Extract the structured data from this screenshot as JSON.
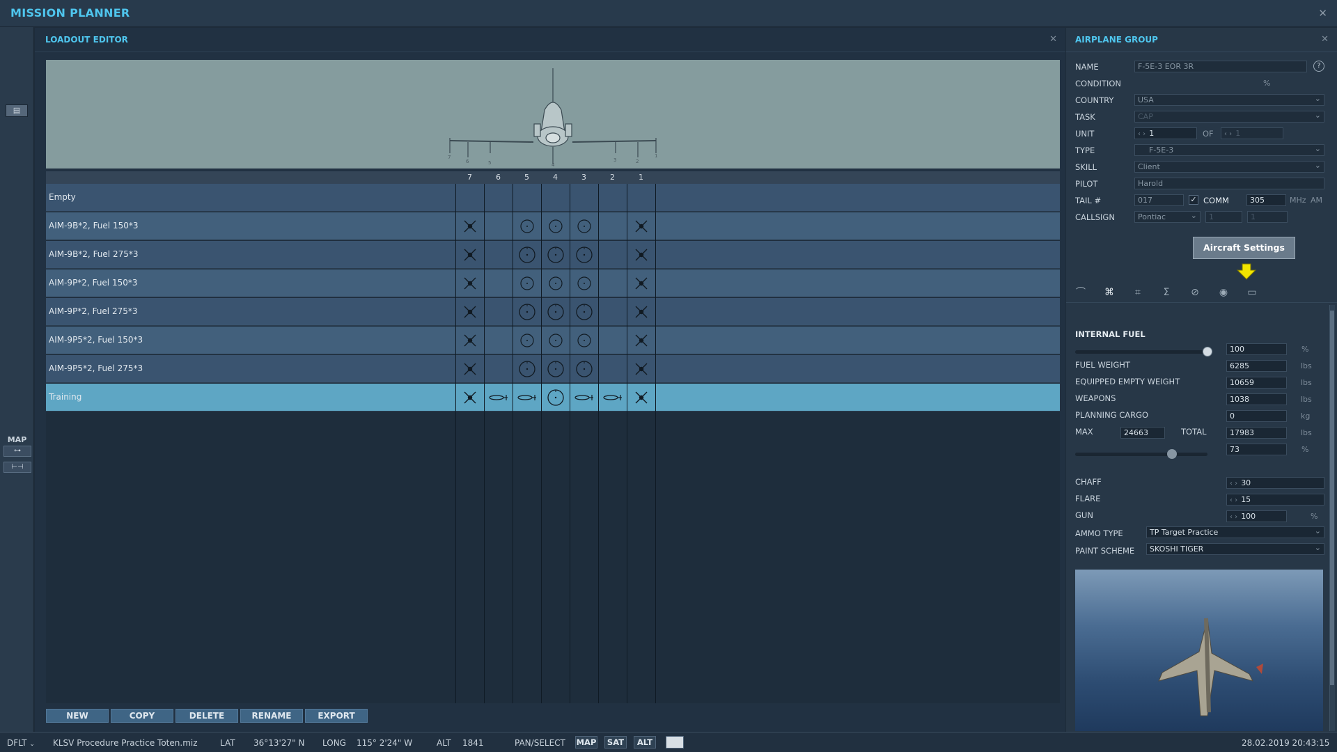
{
  "app": {
    "title": "MISSION PLANNER",
    "close": "✕"
  },
  "leftbar": {
    "map_label": "MAP",
    "map_btn1": "⊶",
    "map_btn2": "⊢⊣",
    "clipboard": "▤"
  },
  "loadout": {
    "title": "LOADOUT EDITOR",
    "close": "✕",
    "stations": [
      "7",
      "6",
      "5",
      "4",
      "3",
      "2",
      "1"
    ],
    "rows": [
      {
        "name": "Empty",
        "stores": [
          "",
          "",
          "",
          "",
          "",
          "",
          ""
        ]
      },
      {
        "name": "AIM-9B*2, Fuel 150*3",
        "stores": [
          "missile",
          "",
          "tank-small",
          "tank-small",
          "tank-small",
          "",
          "missile"
        ]
      },
      {
        "name": "AIM-9B*2, Fuel 275*3",
        "stores": [
          "missile",
          "",
          "tank",
          "tank",
          "tank",
          "",
          "missile"
        ]
      },
      {
        "name": "AIM-9P*2, Fuel 150*3",
        "stores": [
          "missile",
          "",
          "tank-small",
          "tank-small",
          "tank-small",
          "",
          "missile"
        ]
      },
      {
        "name": "AIM-9P*2, Fuel 275*3",
        "stores": [
          "missile",
          "",
          "tank",
          "tank",
          "tank",
          "",
          "missile"
        ]
      },
      {
        "name": "AIM-9P5*2, Fuel 150*3",
        "stores": [
          "missile",
          "",
          "tank-small",
          "tank-small",
          "tank-small",
          "",
          "missile"
        ]
      },
      {
        "name": "AIM-9P5*2, Fuel 275*3",
        "stores": [
          "missile",
          "",
          "tank",
          "tank",
          "tank",
          "",
          "missile"
        ]
      },
      {
        "name": "Training",
        "stores": [
          "missile",
          "pod",
          "pod",
          "tank",
          "pod",
          "pod",
          "missile"
        ]
      }
    ],
    "selected_row": "Training",
    "buttons": {
      "new": "NEW",
      "copy": "COPY",
      "delete": "DELETE",
      "rename": "RENAME",
      "export": "EXPORT"
    }
  },
  "group": {
    "title": "AIRPLANE GROUP",
    "close": "✕",
    "help": "?",
    "name_label": "NAME",
    "name_value": "F-5E-3 EOR 3R",
    "condition_label": "CONDITION",
    "condition_unit": "%",
    "country_label": "COUNTRY",
    "country_value": "USA",
    "task_label": "TASK",
    "task_value": "CAP",
    "unit_label": "UNIT",
    "unit_value": "1",
    "unit_of": "OF",
    "unit_total": "1",
    "type_label": "TYPE",
    "type_value": "F-5E-3",
    "skill_label": "SKILL",
    "skill_value": "Client",
    "pilot_label": "PILOT",
    "pilot_value": "Harold",
    "tail_label": "TAIL #",
    "tail_value": "017",
    "comm_label": "COMM",
    "comm_value": "305",
    "comm_unit": "MHz",
    "comm_mod": "AM",
    "callsign_label": "CALLSIGN",
    "callsign_value": "Pontiac",
    "callsign_n1": "1",
    "callsign_n2": "1",
    "aircraft_settings": "Aircraft Settings",
    "tabs": [
      "route-icon",
      "payload-icon",
      "properties-icon",
      "summary-icon",
      "failures-icon",
      "radio-icon",
      "briefing-icon"
    ]
  },
  "fuel": {
    "section": "INTERNAL FUEL",
    "fuel_pct": "100",
    "pct_unit": "%",
    "fuel_pct_fraction": 1.0,
    "fuel_weight_label": "FUEL WEIGHT",
    "fuel_weight": "6285",
    "empty_weight_label": "EQUIPPED EMPTY WEIGHT",
    "empty_weight": "10659",
    "weapons_label": "WEAPONS",
    "weapons": "1038",
    "cargo_label": "PLANNING CARGO",
    "cargo": "0",
    "cargo_unit": "kg",
    "max_label": "MAX",
    "max": "24663",
    "total_label": "TOTAL",
    "total": "17983",
    "total_pct": "73",
    "total_pct_fraction": 0.73,
    "lbs": "lbs",
    "chaff_label": "CHAFF",
    "chaff": "30",
    "flare_label": "FLARE",
    "flare": "15",
    "gun_label": "GUN",
    "gun": "100",
    "ammo_label": "AMMO TYPE",
    "ammo": "TP Target Practice",
    "paint_label": "PAINT SCHEME",
    "paint": "SKOSHI TIGER"
  },
  "statusbar": {
    "profile": "DFLT",
    "mission": "KLSV  Procedure Practice Toten.miz",
    "lat_label": "LAT",
    "lat": "36°13'27\" N",
    "long_label": "LONG",
    "long": "115° 2'24\" W",
    "alt_label": "ALT",
    "alt": "1841",
    "mode": "PAN/SELECT",
    "map": "MAP",
    "sat": "SAT",
    "alt_btn": "ALT",
    "datetime": "28.02.2019 20:43:15"
  }
}
